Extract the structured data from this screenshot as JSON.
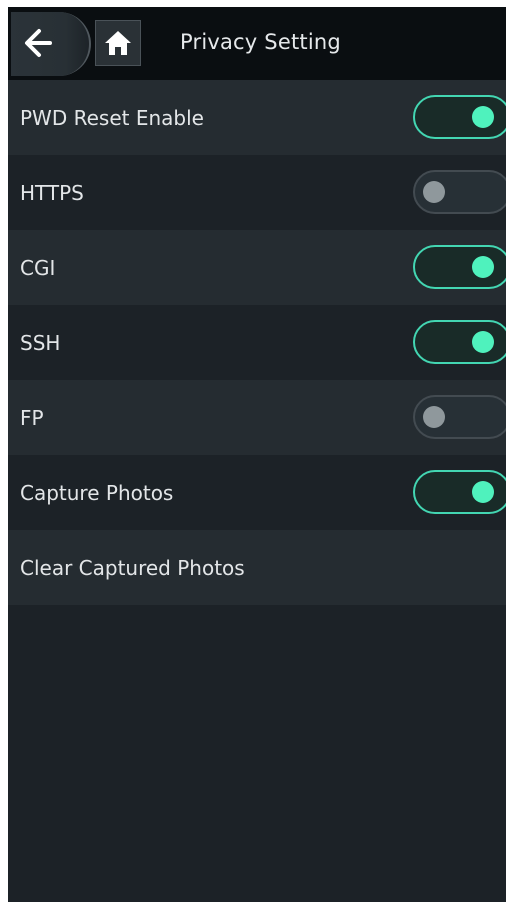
{
  "header": {
    "title": "Privacy Setting",
    "back_icon": "arrow-left-icon",
    "home_icon": "home-icon"
  },
  "settings": [
    {
      "label": "PWD Reset Enable",
      "toggle": true,
      "on": true
    },
    {
      "label": "HTTPS",
      "toggle": true,
      "on": false
    },
    {
      "label": "CGI",
      "toggle": true,
      "on": true
    },
    {
      "label": "SSH",
      "toggle": true,
      "on": true
    },
    {
      "label": "FP",
      "toggle": true,
      "on": false
    },
    {
      "label": "Capture Photos",
      "toggle": true,
      "on": true
    },
    {
      "label": "Clear Captured Photos",
      "toggle": false
    }
  ],
  "colors": {
    "toggle_on": "#4ff2bd",
    "toggle_off": "#8f989c",
    "background": "#1c2227",
    "header": "#0a0e11"
  }
}
